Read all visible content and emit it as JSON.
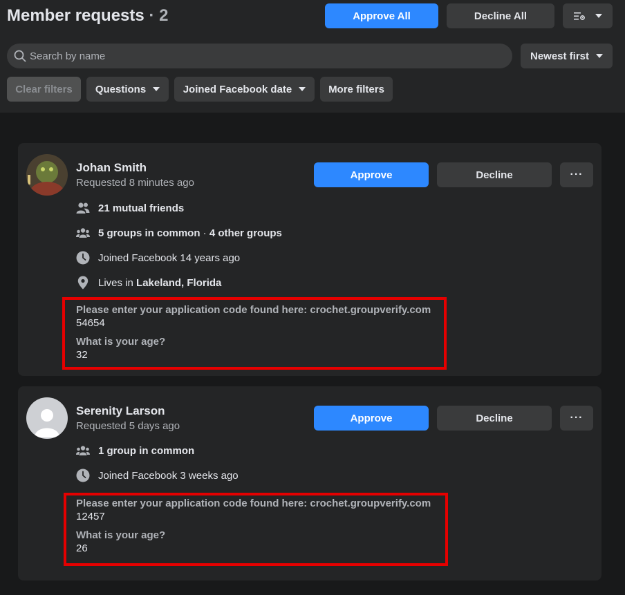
{
  "header": {
    "title": "Member requests",
    "separator": "·",
    "count": "2",
    "approve_all_label": "Approve All",
    "decline_all_label": "Decline All",
    "settings_icon": "filter-settings-icon"
  },
  "search": {
    "placeholder": "Search by name",
    "value": ""
  },
  "sort": {
    "label": "Newest first"
  },
  "filters": {
    "clear_label": "Clear filters",
    "questions_label": "Questions",
    "joined_label": "Joined Facebook date",
    "more_label": "More filters"
  },
  "colors": {
    "accent": "#2d88ff",
    "highlight_box": "#e50000",
    "card_bg": "#242526",
    "page_bg": "#18191a"
  },
  "requests": [
    {
      "name": "Johan Smith",
      "requested": "Requested 8 minutes ago",
      "approve_label": "Approve",
      "decline_label": "Decline",
      "more_label": "···",
      "mutual_friends": "21 mutual friends",
      "groups_common": "5 groups in common",
      "groups_sep": " · ",
      "groups_other": "4 other groups",
      "joined": "Joined Facebook 14 years ago",
      "lives_prefix": "Lives in ",
      "lives_place": "Lakeland, Florida",
      "q1": "Please enter your application code found here: crochet.groupverify.com",
      "a1": "54654",
      "q2": "What is your age?",
      "a2": "32"
    },
    {
      "name": "Serenity Larson",
      "requested": "Requested 5 days ago",
      "approve_label": "Approve",
      "decline_label": "Decline",
      "more_label": "···",
      "groups_common": "1 group in common",
      "joined": "Joined Facebook 3 weeks ago",
      "q1": "Please enter your application code found here: crochet.groupverify.com",
      "a1": "12457",
      "q2": "What is your age?",
      "a2": "26"
    }
  ]
}
